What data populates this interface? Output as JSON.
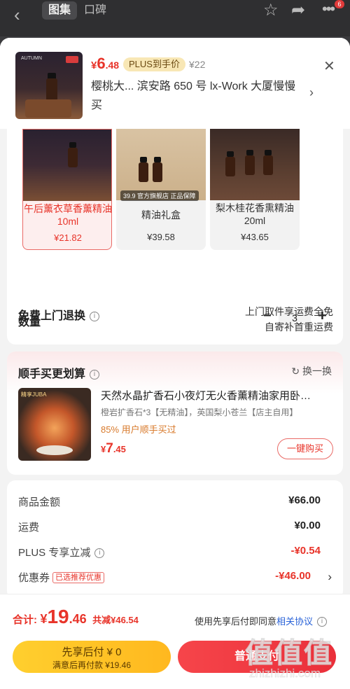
{
  "topbar": {
    "tab_gallery": "图集",
    "tab_reviews": "口碑",
    "notif_count": "6"
  },
  "product": {
    "price_yen": "¥",
    "price_int": "6",
    "price_dec": ".48",
    "plus_badge": "PLUS到手价",
    "orig_price": "¥22",
    "title": "樱桃大...  滨安路 650 号 lx-Work 大厦慢慢买",
    "thumb_brand": "AUTUMN"
  },
  "skus": [
    {
      "name": "午后薰衣草香薰精油10ml",
      "price": "¥21.82",
      "selected": true
    },
    {
      "name": "精油礼盒",
      "price": "¥39.58",
      "img_label": "39.9 官方旗舰店 正品保障"
    },
    {
      "name": "梨木桂花香熏精油20ml",
      "price": "¥43.65"
    }
  ],
  "quantity": {
    "label": "数量",
    "minus": "−",
    "value": "3",
    "plus": "+"
  },
  "returns": {
    "label": "免费上门退换",
    "line1": "上门取件享运费全免",
    "line2": "自寄补首重运费"
  },
  "bundle": {
    "title": "顺手买更划算",
    "swap": "换一换",
    "img_label": "精享JUBA",
    "name": "天然水晶扩香石小夜灯无火香薰精油家用卧…",
    "spec": "橙岩扩香石*3【无精油】，英国梨小苍兰【店主自用】",
    "buyers": "85% 用户顺手买过",
    "price_yen": "¥",
    "price_int": "7",
    "price_dec": ".45",
    "buy": "一键购买"
  },
  "summary": {
    "rows": [
      {
        "label": "商品金额",
        "value": "¥66.00"
      },
      {
        "label": "运费",
        "value": "¥0.00"
      },
      {
        "label": "PLUS 专享立减",
        "value": "-¥0.54"
      },
      {
        "label": "优惠券",
        "tag": "已选推荐优惠",
        "value": "-¥46.00"
      }
    ]
  },
  "footer": {
    "total_label": "合计:",
    "total_yen": "¥",
    "total_int": "19",
    "total_dec": ".46",
    "total_save": "共减¥46.54",
    "agree_text": "使用先享后付即同意",
    "agree_link": "相关协议",
    "later_l1": "先享后付 ¥ 0",
    "later_l2": "满意后再付款 ¥19.46",
    "normal": "普通支付"
  },
  "watermark": {
    "big": "值值值",
    "small": "zhizhizhi.com"
  },
  "colors": {
    "accent_red": "#e8342a",
    "plus_gold": "#f8e7b5",
    "pay_later_yellow": "#ffc526",
    "link_blue": "#2a63d8"
  }
}
